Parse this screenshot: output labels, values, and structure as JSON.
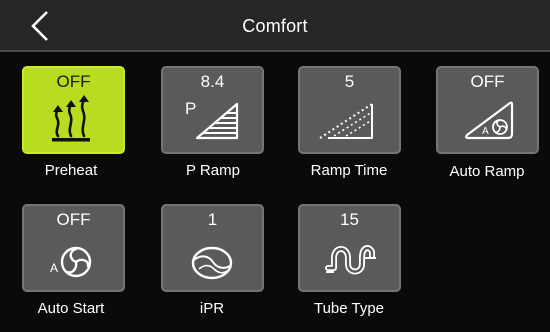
{
  "header": {
    "title": "Comfort",
    "back_icon": "chevron-left-icon"
  },
  "colors": {
    "active_tile": "#b8dc20",
    "tile": "#5a5a5a",
    "header": "#262626"
  },
  "tiles": [
    {
      "label": "Preheat",
      "value": "OFF",
      "icon": "heat-waves-icon",
      "active": true
    },
    {
      "label": "P Ramp",
      "value": "8.4",
      "icon": "pressure-ramp-icon",
      "active": false
    },
    {
      "label": "Ramp Time",
      "value": "5",
      "icon": "ramp-time-icon",
      "active": false
    },
    {
      "label": "Auto Ramp",
      "value": "OFF",
      "icon": "auto-ramp-icon",
      "active": false
    },
    {
      "label": "Auto Start",
      "value": "OFF",
      "icon": "auto-start-fan-icon",
      "active": false
    },
    {
      "label": "iPR",
      "value": "1",
      "icon": "ipr-icon",
      "active": false
    },
    {
      "label": "Tube Type",
      "value": "15",
      "icon": "tube-icon",
      "active": false
    }
  ]
}
